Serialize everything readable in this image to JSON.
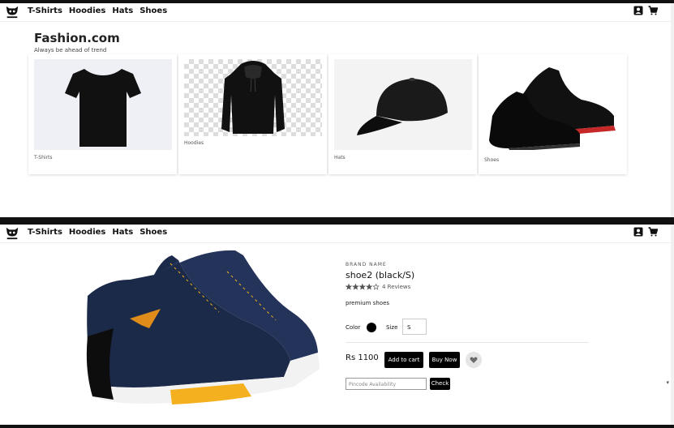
{
  "nav": {
    "logo_alt": "Store logo",
    "links": [
      "T-Shirts",
      "Hoodies",
      "Hats",
      "Shoes"
    ],
    "icons": [
      "account-icon",
      "cart-icon"
    ]
  },
  "home": {
    "title": "Fashion.com",
    "tagline": "Always be ahead of trend",
    "categories": [
      {
        "label": "T-Shirts"
      },
      {
        "label": "Hoodies"
      },
      {
        "label": "Hats"
      },
      {
        "label": "Shoes"
      }
    ]
  },
  "product": {
    "brand_label": "BRAND NAME",
    "name": "shoe2 (black/S)",
    "rating": 4,
    "rating_max": 5,
    "reviews": "4 Reviews",
    "description": "premium shoes",
    "color_label": "Color",
    "color_value": "#000000",
    "size_label": "Size",
    "size_value": "S",
    "price": "Rs 1100",
    "add_to_cart": "Add to cart",
    "buy_now": "Buy Now",
    "pincode_placeholder": "Pincode Availability",
    "check": "Check"
  }
}
